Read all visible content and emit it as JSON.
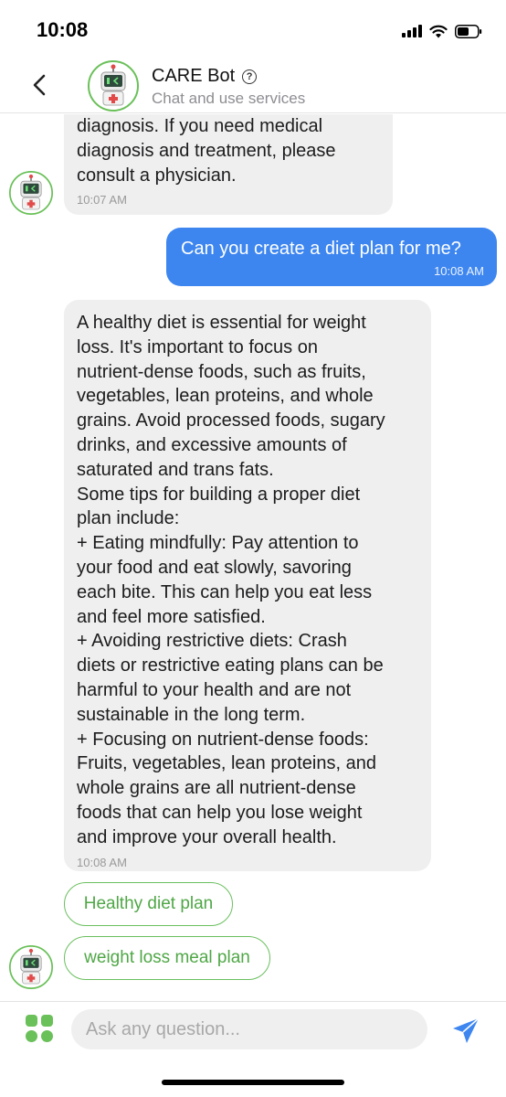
{
  "status_bar": {
    "time": "10:08"
  },
  "header": {
    "title": "CARE Bot",
    "subtitle": "Chat and use services"
  },
  "messages": [
    {
      "sender": "bot",
      "lines": [
        "diagnosis. If you need medical",
        "diagnosis and treatment, please",
        "consult a physician."
      ],
      "time": "10:07 AM"
    },
    {
      "sender": "user",
      "text": "Can you create a diet plan for me?",
      "time": "10:08 AM"
    },
    {
      "sender": "bot",
      "lines": [
        "A healthy diet is essential for weight",
        "loss. It's important to focus on",
        "nutrient-dense foods, such as fruits,",
        "vegetables, lean proteins, and whole",
        "grains. Avoid processed foods, sugary",
        "drinks, and excessive amounts of",
        "saturated and trans fats.",
        "Some tips for building a proper diet",
        "plan include:",
        "+ Eating mindfully: Pay attention to",
        "your food and eat slowly, savoring",
        "each bite. This can help you eat less",
        "and feel more satisfied.",
        "+ Avoiding restrictive diets: Crash",
        "diets or restrictive eating plans can be",
        "harmful to your health and are not",
        "sustainable in the long term.",
        "+ Focusing on nutrient-dense foods:",
        "Fruits, vegetables, lean proteins, and",
        "whole grains are all nutrient-dense",
        "foods that can help you lose weight",
        "and improve your overall health."
      ],
      "time": "10:08 AM"
    }
  ],
  "suggestions": [
    "Healthy diet plan",
    "weight loss meal plan"
  ],
  "input": {
    "placeholder": "Ask any question..."
  },
  "colors": {
    "user_bubble": "#3d86f0",
    "bot_bubble": "#efefef",
    "accent_green": "#6ac059"
  },
  "icons": {
    "back": "chevron-left-icon",
    "help": "question-circle-icon",
    "menu": "grid-icon",
    "send": "paper-plane-icon"
  }
}
